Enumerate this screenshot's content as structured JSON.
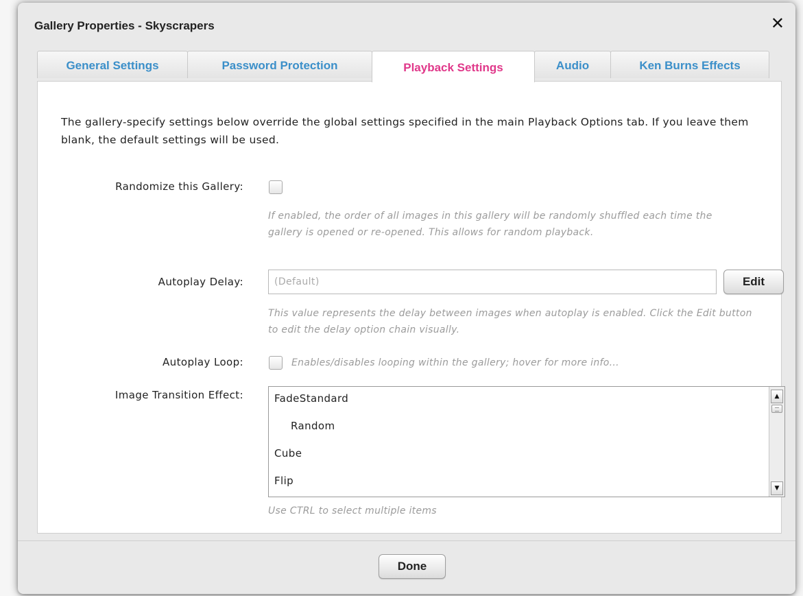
{
  "dialog": {
    "title": "Gallery Properties - Skyscrapers",
    "close_glyph": "✕",
    "close_icon": "close-icon"
  },
  "tabs": [
    {
      "label": "General Settings",
      "active": false
    },
    {
      "label": "Password Protection",
      "active": false
    },
    {
      "label": "Playback Settings",
      "active": true
    },
    {
      "label": "Audio",
      "active": false
    },
    {
      "label": "Ken Burns Effects",
      "active": false
    }
  ],
  "colors": {
    "tab_text": "#3b8fc9",
    "active_tab_text": "#e0388a"
  },
  "intro": "The gallery-specify settings below override the global settings specified in the main Playback Options tab.  If you leave them blank, the default settings will be used.",
  "randomize": {
    "label": "Randomize this Gallery:",
    "checked": false,
    "hint": "If enabled, the order of all images in this gallery will be randomly shuffled each time the gallery is opened or re-opened.  This allows for random playback."
  },
  "autoplay_delay": {
    "label": "Autoplay Delay:",
    "placeholder": "(Default)",
    "value": "",
    "edit_label": "Edit",
    "hint": "This value represents the delay between images when autoplay is enabled. Click the Edit button to edit the delay option chain visually."
  },
  "autoplay_loop": {
    "label": "Autoplay Loop:",
    "checked": false,
    "hint": "Enables/disables looping within the gallery; hover for more info..."
  },
  "transition": {
    "label": "Image Transition Effect:",
    "options": [
      "FadeStandard",
      "Random",
      "Cube",
      "Flip"
    ],
    "hint": "Use CTRL to select multiple items",
    "scroll_up_glyph": "▲",
    "scroll_down_glyph": "▼"
  },
  "footer": {
    "done_label": "Done"
  }
}
